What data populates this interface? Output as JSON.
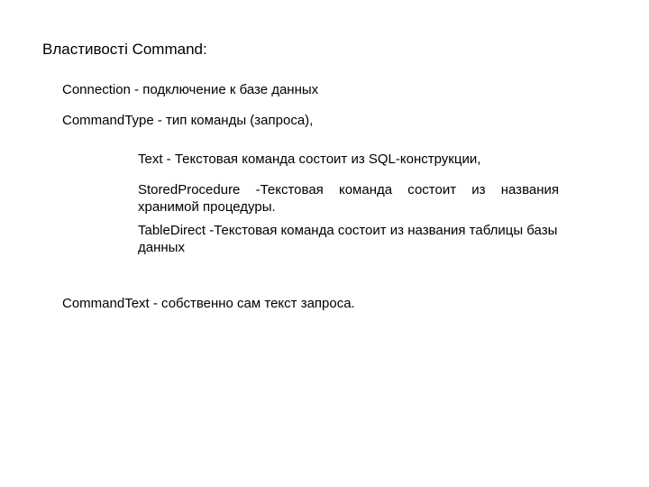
{
  "title": "Властивості Command:",
  "props": {
    "connection": "Connection - подключение к базе данных",
    "commandType": "CommandType - тип команды (запроса),"
  },
  "subtypes": {
    "text": "Text - Текстовая команда состоит из SQL-конструкции,",
    "storedProcedure": "StoredProcedure -Текстовая команда состоит из названия хранимой процедуры.",
    "tableDirect": "TableDirect -Текстовая команда состоит из названия таблицы базы данных"
  },
  "commandText": "CommandText - собственно сам текст запроса."
}
